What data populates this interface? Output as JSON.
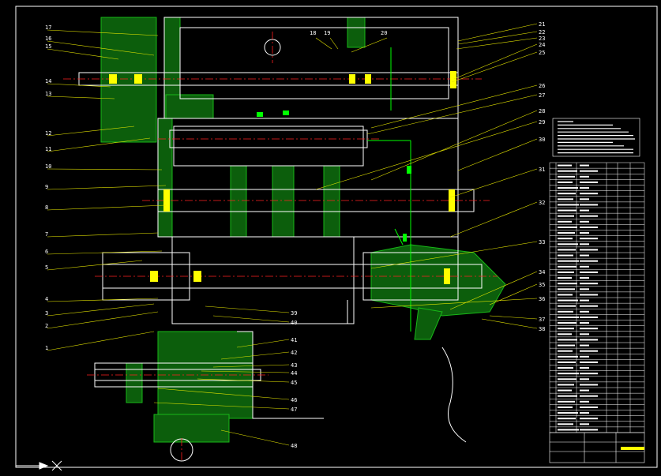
{
  "drawing": {
    "colors": {
      "background": "#000000",
      "outline": "#ffffff",
      "hatch": "#18b818",
      "centerline": "#ff2020",
      "callout": "#e6e600",
      "highlight": "#ffff00",
      "accent_green": "#00ff00"
    },
    "callouts_left": [
      "17",
      "16",
      "15",
      "14",
      "13",
      "12",
      "11",
      "10",
      "9",
      "8",
      "7",
      "6",
      "5",
      "4",
      "3",
      "2",
      "1"
    ],
    "callouts_top": [
      "18",
      "19",
      "20"
    ],
    "callouts_right": [
      "21",
      "22",
      "23",
      "24",
      "25",
      "26",
      "27",
      "28",
      "29",
      "30",
      "31",
      "32",
      "33",
      "34",
      "35",
      "36",
      "37",
      "38"
    ],
    "callouts_bottom": [
      "39",
      "40",
      "41",
      "42",
      "43",
      "44",
      "45",
      "46",
      "47",
      "48"
    ]
  },
  "parts_table": {
    "row_count": 48
  }
}
